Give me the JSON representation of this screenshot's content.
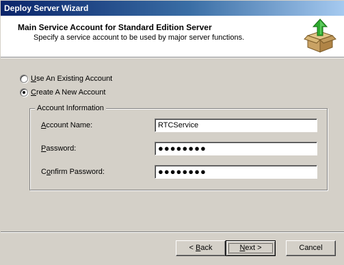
{
  "window": {
    "title": "Deploy Server Wizard"
  },
  "header": {
    "title": "Main Service Account for Standard Edition Server",
    "subtitle": "Specify a service account to be used by major server functions.",
    "icon": "box-up-arrow-icon"
  },
  "options": [
    {
      "label_u": "U",
      "label_rest": "se An Existing Account",
      "checked": false
    },
    {
      "label_u": "C",
      "label_rest": "reate A New Account",
      "checked": true
    }
  ],
  "group": {
    "legend": "Account Information",
    "fields": [
      {
        "label_pre": "",
        "label_u": "A",
        "label_post": "ccount Name:",
        "value": "RTCService"
      },
      {
        "label_pre": "",
        "label_u": "P",
        "label_post": "assword:",
        "value": "●●●●●●●●"
      },
      {
        "label_pre": "C",
        "label_u": "o",
        "label_post": "nfirm Password:",
        "value": "●●●●●●●●"
      }
    ]
  },
  "buttons": {
    "back_pre": "< ",
    "back_u": "B",
    "back_post": "ack",
    "next_u": "N",
    "next_post": "ext >",
    "cancel": "Cancel"
  },
  "colors": {
    "titlebar": "#0a246a",
    "face": "#d4d0c8",
    "icon_arrow": "#2eaa2e"
  }
}
